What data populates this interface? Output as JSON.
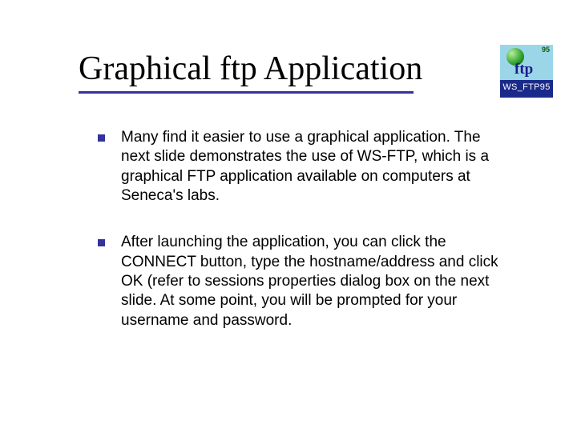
{
  "title": "Graphical ftp Application",
  "logo": {
    "small_text": "95",
    "script_text": "ftp",
    "label": "WS_FTP95"
  },
  "bullets": [
    "Many find it easier to use a graphical application. The next slide demonstrates the use of WS-FTP, which is a graphical FTP application available on computers at Seneca's labs.",
    "After launching the application, you can click the CONNECT button, type the hostname/address and click OK (refer to sessions properties dialog box on the next slide. At some point, you will be prompted for your username and password."
  ]
}
